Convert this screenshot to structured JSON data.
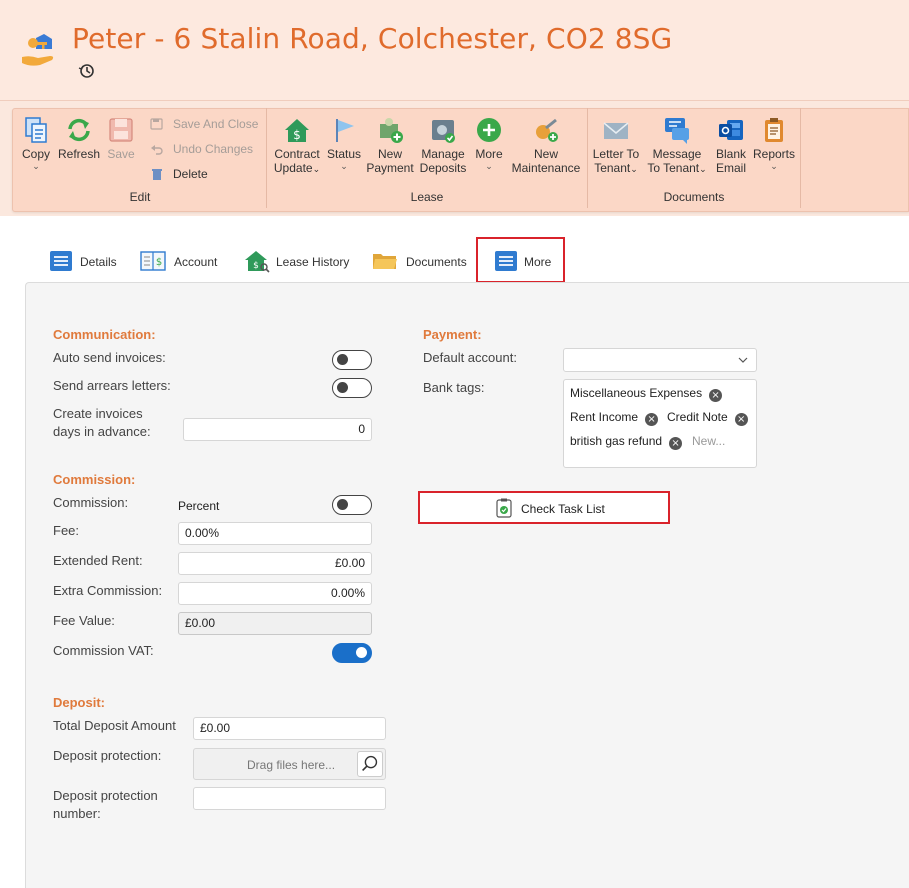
{
  "window": {
    "title": "Peter - 6 Stalin Road, Colchester, CO2 8SG"
  },
  "ribbon": {
    "edit": {
      "group_label": "Edit",
      "copy": "Copy",
      "refresh": "Refresh",
      "save": "Save",
      "save_and_close": "Save And Close",
      "undo_changes": "Undo Changes",
      "delete": "Delete"
    },
    "lease": {
      "group_label": "Lease",
      "contract_update": [
        "Contract",
        "Update"
      ],
      "status": "Status",
      "new_payment": [
        "New",
        "Payment"
      ],
      "manage_deposits": [
        "Manage",
        "Deposits"
      ],
      "more": "More",
      "new_maintenance": [
        "New",
        "Maintenance"
      ]
    },
    "documents": {
      "group_label": "Documents",
      "letter_to_tenant": [
        "Letter To",
        "Tenant"
      ],
      "message_to_tenant": [
        "Message",
        "To Tenant"
      ],
      "blank_email": [
        "Blank",
        "Email"
      ],
      "reports": "Reports"
    }
  },
  "tabs": [
    {
      "label": "Details"
    },
    {
      "label": "Account"
    },
    {
      "label": "Lease History"
    },
    {
      "label": "Documents"
    },
    {
      "label": "More"
    }
  ],
  "communication": {
    "heading": "Communication:",
    "auto_send_invoices": "Auto send invoices:",
    "send_arrears_letters": "Send arrears letters:",
    "create_invoices_line1": "Create invoices",
    "create_invoices_line2": "days in advance:",
    "days_value": "0"
  },
  "commission": {
    "heading": "Commission:",
    "commission_label": "Commission:",
    "commission_mode": "Percent",
    "fee_label": "Fee:",
    "fee_value": "0.00%",
    "extended_rent_label": "Extended Rent:",
    "extended_rent_value": "£0.00",
    "extra_commission_label": "Extra Commission:",
    "extra_commission_value": "0.00%",
    "fee_value_label": "Fee Value:",
    "fee_value_value": "£0.00",
    "commission_vat_label": "Commission VAT:",
    "commission_vat_on": true
  },
  "deposit": {
    "heading": "Deposit:",
    "total_label": "Total Deposit Amount",
    "total_value": "£0.00",
    "protection_label": "Deposit protection:",
    "protection_placeholder": "Drag files here...",
    "protection_number_line1": "Deposit protection",
    "protection_number_line2": "number:",
    "protection_number_value": ""
  },
  "payment": {
    "heading": "Payment:",
    "default_account_label": "Default account:",
    "default_account_value": "",
    "bank_tags_label": "Bank tags:",
    "bank_tags": [
      "Miscellaneous Expenses",
      "Rent Income",
      "Credit Note",
      "british gas refund"
    ],
    "new_tag_placeholder": "New..."
  },
  "check_task_list": "Check Task List",
  "colors": {
    "accent": "#e06b2c",
    "highlight_box": "#d9232b",
    "toggle_on": "#1a6fc9"
  }
}
